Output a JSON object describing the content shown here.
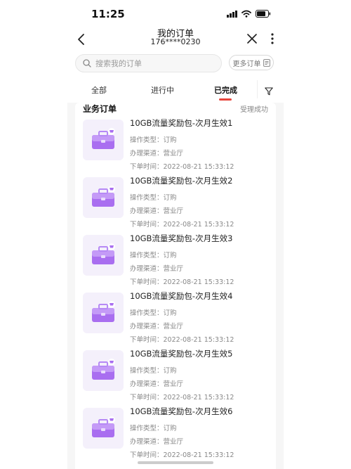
{
  "status_bar": {
    "time": "11:25"
  },
  "header": {
    "title": "我的订单",
    "phone": "176****0230"
  },
  "search": {
    "placeholder": "搜索我的订单",
    "more_orders_label": "更多订单"
  },
  "tabs": [
    {
      "label": "全部",
      "active": false
    },
    {
      "label": "进行中",
      "active": false
    },
    {
      "label": "已完成",
      "active": true
    }
  ],
  "section": {
    "title": "业务订单",
    "status": "受理成功"
  },
  "orders": [
    {
      "name": "10GB流量奖励包-次月生效1",
      "type_label": "操作类型：",
      "type": "订购",
      "channel_label": "办理渠道：",
      "channel": "营业厅",
      "time_label": "下单时间：",
      "time": "2022-08-21 15:33:12"
    },
    {
      "name": "10GB流量奖励包-次月生效2",
      "type_label": "操作类型：",
      "type": "订购",
      "channel_label": "办理渠道：",
      "channel": "营业厅",
      "time_label": "下单时间：",
      "time": "2022-08-21 15:33:12"
    },
    {
      "name": "10GB流量奖励包-次月生效3",
      "type_label": "操作类型：",
      "type": "订购",
      "channel_label": "办理渠道：",
      "channel": "营业厅",
      "time_label": "下单时间：",
      "time": "2022-08-21 15:33:12"
    },
    {
      "name": "10GB流量奖励包-次月生效4",
      "type_label": "操作类型：",
      "type": "订购",
      "channel_label": "办理渠道：",
      "channel": "营业厅",
      "time_label": "下单时间：",
      "time": "2022-08-21 15:33:12"
    },
    {
      "name": "10GB流量奖励包-次月生效5",
      "type_label": "操作类型：",
      "type": "订购",
      "channel_label": "办理渠道：",
      "channel": "营业厅",
      "time_label": "下单时间：",
      "time": "2022-08-21 15:33:12"
    },
    {
      "name": "10GB流量奖励包-次月生效6",
      "type_label": "操作类型：",
      "type": "订购",
      "channel_label": "办理渠道：",
      "channel": "营业厅",
      "time_label": "下单时间：",
      "time": "2022-08-21 15:33:12"
    }
  ],
  "icons": {
    "back": "chevron-left-icon",
    "close": "close-icon",
    "more": "more-vertical-icon",
    "search": "search-icon",
    "order_list": "order-list-icon",
    "filter": "filter-icon",
    "product": "purple-briefcase-cart-icon"
  },
  "colors": {
    "accent": "#e8453c",
    "product_purple": "#a96ef0",
    "page_bg": "#f6f6f6"
  }
}
